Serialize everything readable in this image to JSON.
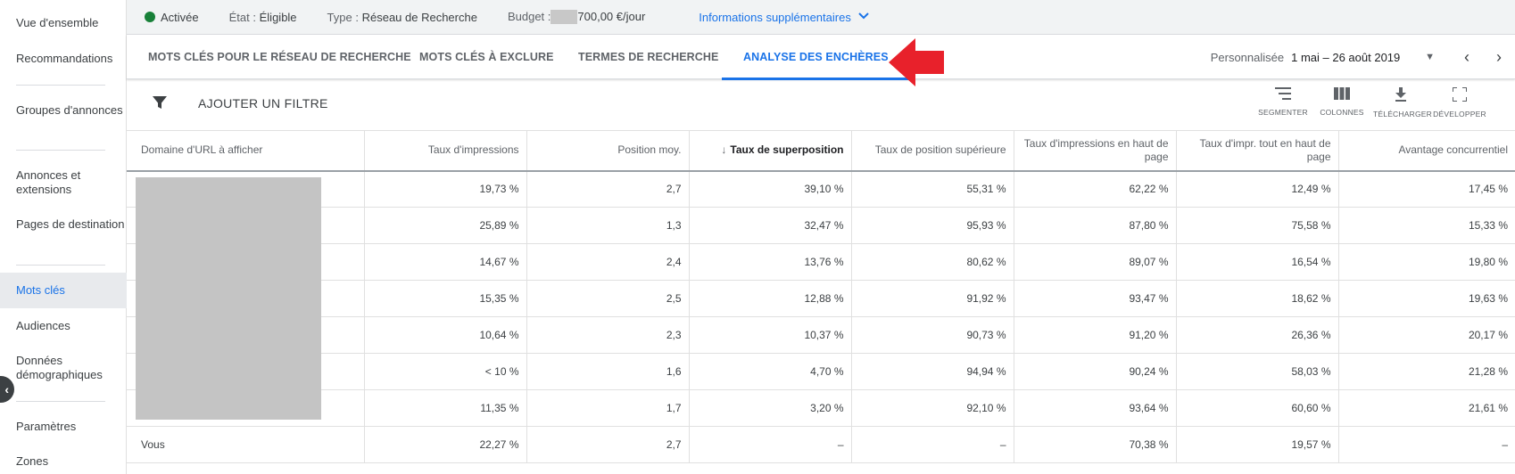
{
  "sidebar": {
    "items": [
      {
        "label": "Vue d'ensemble"
      },
      {
        "label": "Recommandations"
      },
      {
        "label": "Groupes d'annonces"
      },
      {
        "label": "Annonces et extensions"
      },
      {
        "label": "Pages de destination"
      },
      {
        "label": "Mots clés"
      },
      {
        "label": "Audiences"
      },
      {
        "label": "Données démographiques"
      },
      {
        "label": "Paramètres"
      },
      {
        "label": "Zones"
      }
    ],
    "active_item": "Mots clés"
  },
  "infobar": {
    "status": "Activée",
    "etat_key": "État :",
    "etat_value": "Éligible",
    "type_key": "Type :",
    "type_value": "Réseau de Recherche",
    "budget_key": "Budget :",
    "budget_value": "700,00 €/jour",
    "more_info": "Informations supplémentaires"
  },
  "tabs": [
    {
      "label": "MOTS CLÉS POUR LE RÉSEAU DE RECHERCHE"
    },
    {
      "label": "MOTS CLÉS À EXCLURE"
    },
    {
      "label": "TERMES DE RECHERCHE"
    },
    {
      "label": "ANALYSE DES ENCHÈRES"
    }
  ],
  "date_range": {
    "label": "Personnalisée",
    "value": "1 mai – 26 août 2019"
  },
  "toolbar": {
    "filter_label": "AJOUTER UN FILTRE",
    "segment": "SEGMENTER",
    "columns": "COLONNES",
    "download": "TÉLÉCHARGER",
    "expand": "DÉVELOPPER"
  },
  "table": {
    "headers": [
      "Domaine d'URL à afficher",
      "Taux d'impressions",
      "Position moy.",
      "Taux de superposition",
      "Taux de position supérieure",
      "Taux d'impressions en haut de page",
      "Taux d'impr. tout en haut de page",
      "Avantage concurrentiel"
    ],
    "rows": [
      [
        "",
        "19,73 %",
        "2,7",
        "39,10 %",
        "55,31 %",
        "62,22 %",
        "12,49 %",
        "17,45 %"
      ],
      [
        "",
        "25,89 %",
        "1,3",
        "32,47 %",
        "95,93 %",
        "87,80 %",
        "75,58 %",
        "15,33 %"
      ],
      [
        "",
        "14,67 %",
        "2,4",
        "13,76 %",
        "80,62 %",
        "89,07 %",
        "16,54 %",
        "19,80 %"
      ],
      [
        "",
        "15,35 %",
        "2,5",
        "12,88 %",
        "91,92 %",
        "93,47 %",
        "18,62 %",
        "19,63 %"
      ],
      [
        "",
        "10,64 %",
        "2,3",
        "10,37 %",
        "90,73 %",
        "91,20 %",
        "26,36 %",
        "20,17 %"
      ],
      [
        "",
        "< 10 %",
        "1,6",
        "4,70 %",
        "94,94 %",
        "90,24 %",
        "58,03 %",
        "21,28 %"
      ],
      [
        "",
        "11,35 %",
        "1,7",
        "3,20 %",
        "92,10 %",
        "93,64 %",
        "60,60 %",
        "21,61 %"
      ],
      [
        "Vous",
        "22,27 %",
        "2,7",
        "–",
        "–",
        "70,38 %",
        "19,57 %",
        "–"
      ]
    ]
  },
  "colors": {
    "accent": "#1a73e8",
    "status_green": "#188038",
    "arrow_red": "#e8212b"
  }
}
